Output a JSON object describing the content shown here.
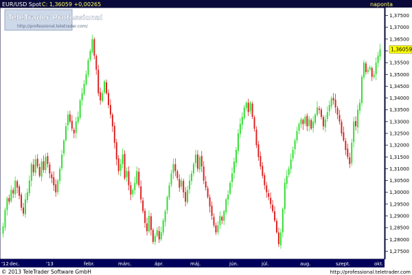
{
  "header": {
    "instrument": "EUR/USD Spot",
    "quote": "C: 1,36059 +0,00265",
    "period": "naponta"
  },
  "brand": {
    "name": "TeleTrader Professional",
    "url": "http://professional.teletrader.com/"
  },
  "footer": {
    "copyright": "© 2013 TeleTrader Software GmbH",
    "url": "http://professional.teletrader.com"
  },
  "colors": {
    "up": "#33dd33",
    "down": "#dd2222",
    "header_bg": "#0a0a3a",
    "axis_bg": "#00005a",
    "price_marker_bg": "#ffff00"
  },
  "chart_data": {
    "type": "candlestick",
    "title": "EUR/USD Spot",
    "interval": "naponta",
    "ylim": [
      1.2725,
      1.3775
    ],
    "y_ticks": [
      "1,27500",
      "1,28000",
      "1,28500",
      "1,29000",
      "1,29500",
      "1,30000",
      "1,30500",
      "1,31000",
      "1,31500",
      "1,32000",
      "1,32500",
      "1,33000",
      "1,33500",
      "1,34000",
      "1,34500",
      "1,35000",
      "1,35500",
      "1,36000",
      "1,36500",
      "1,37000",
      "1,37500"
    ],
    "last_price_label": "1,36059",
    "x_labels": [
      "'12",
      "dec.",
      "'13",
      "febr.",
      "márc.",
      "ápr.",
      "máj.",
      "jún.",
      "júl.",
      "aug.",
      "szept.",
      "okt."
    ],
    "grid": false,
    "up_color": "#33dd33",
    "down_color": "#dd2222",
    "closes": [
      1.2855,
      1.2925,
      1.2975,
      1.296,
      1.301,
      1.2995,
      1.305,
      1.302,
      1.2985,
      1.2935,
      1.291,
      1.297,
      1.3,
      1.305,
      1.312,
      1.3085,
      1.314,
      1.311,
      1.307,
      1.313,
      1.3095,
      1.315,
      1.312,
      1.308,
      1.306,
      1.303,
      1.3,
      1.305,
      1.31,
      1.316,
      1.322,
      1.328,
      1.333,
      1.33,
      1.327,
      1.325,
      1.33,
      1.332,
      1.339,
      1.342,
      1.346,
      1.35,
      1.356,
      1.36,
      1.365,
      1.358,
      1.352,
      1.342,
      1.339,
      1.342,
      1.347,
      1.342,
      1.337,
      1.333,
      1.328,
      1.321,
      1.314,
      1.309,
      1.312,
      1.316,
      1.306,
      1.309,
      1.303,
      1.299,
      1.301,
      1.304,
      1.309,
      1.303,
      1.297,
      1.292,
      1.287,
      1.2835,
      1.29,
      1.284,
      1.279,
      1.2815,
      1.284,
      1.28,
      1.283,
      1.288,
      1.292,
      1.298,
      1.303,
      1.308,
      1.312,
      1.309,
      1.306,
      1.302,
      1.305,
      1.3,
      1.296,
      1.301,
      1.305,
      1.308,
      1.312,
      1.316,
      1.31,
      1.315,
      1.311,
      1.305,
      1.302,
      1.298,
      1.294,
      1.29,
      1.286,
      1.283,
      1.286,
      1.29,
      1.288,
      1.292,
      1.297,
      1.299,
      1.304,
      1.308,
      1.313,
      1.318,
      1.325,
      1.329,
      1.332,
      1.336,
      1.338,
      1.334,
      1.338,
      1.332,
      1.327,
      1.32,
      1.315,
      1.311,
      1.307,
      1.303,
      1.3,
      1.298,
      1.295,
      1.292,
      1.288,
      1.283,
      1.278,
      1.283,
      1.293,
      1.304,
      1.307,
      1.31,
      1.314,
      1.318,
      1.322,
      1.326,
      1.329,
      1.331,
      1.329,
      1.332,
      1.328,
      1.331,
      1.327,
      1.33,
      1.333,
      1.336,
      1.335,
      1.332,
      1.328,
      1.331,
      1.334,
      1.337,
      1.34,
      1.339,
      1.336,
      1.333,
      1.33,
      1.325,
      1.322,
      1.318,
      1.315,
      1.312,
      1.321,
      1.33,
      1.328,
      1.335,
      1.338,
      1.349,
      1.355,
      1.351,
      1.352,
      1.353,
      1.349,
      1.35,
      1.355,
      1.358,
      1.3606
    ]
  }
}
